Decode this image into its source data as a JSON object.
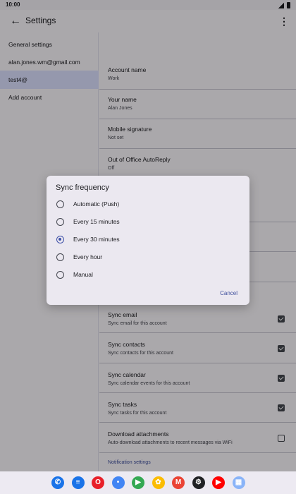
{
  "status": {
    "time": "10:00"
  },
  "appbar": {
    "title": "Settings",
    "back_icon": "arrow-back-icon",
    "more_icon": "more-vert-icon"
  },
  "accounts": [
    {
      "label": "General settings",
      "selected": false
    },
    {
      "label": "alan.jones.wm@gmail.com",
      "selected": false
    },
    {
      "label": "test4@",
      "selected": true
    },
    {
      "label": "Add account",
      "selected": false
    }
  ],
  "prefs": [
    {
      "title": "Account name",
      "subtitle": "Work"
    },
    {
      "title": "Your name",
      "subtitle": "Alan Jones"
    },
    {
      "title": "Mobile signature",
      "subtitle": "Not set"
    },
    {
      "title": "Out of Office AutoReply",
      "subtitle": "Off"
    }
  ],
  "sync_prefs": [
    {
      "title": "Sync email",
      "subtitle": "Sync email for this account",
      "checked": true
    },
    {
      "title": "Sync contacts",
      "subtitle": "Sync contacts for this account",
      "checked": true
    },
    {
      "title": "Sync calendar",
      "subtitle": "Sync calendar events for this account",
      "checked": true
    },
    {
      "title": "Sync tasks",
      "subtitle": "Sync tasks for this account",
      "checked": true
    },
    {
      "title": "Download attachments",
      "subtitle": "Auto-download attachments to recent messages via WiFi",
      "checked": false
    }
  ],
  "section_link": "Notification settings",
  "dialog": {
    "title": "Sync frequency",
    "options": [
      {
        "label": "Automatic (Push)",
        "selected": false
      },
      {
        "label": "Every 15 minutes",
        "selected": false
      },
      {
        "label": "Every 30 minutes",
        "selected": true
      },
      {
        "label": "Every hour",
        "selected": false
      },
      {
        "label": "Manual",
        "selected": false
      }
    ],
    "cancel": "Cancel"
  },
  "dock": [
    {
      "name": "phone-app-icon",
      "glyph": "✆",
      "color": "#1a73e8"
    },
    {
      "name": "messages-app-icon",
      "glyph": "≡",
      "color": "#1a73e8"
    },
    {
      "name": "opera-app-icon",
      "glyph": "O",
      "color": "#e8202a"
    },
    {
      "name": "assistant-app-icon",
      "glyph": "•",
      "color": "#4285f4"
    },
    {
      "name": "play-store-app-icon",
      "glyph": "▶",
      "color": "#34a853"
    },
    {
      "name": "photos-app-icon",
      "glyph": "✿",
      "color": "#fbbc04"
    },
    {
      "name": "gmail-app-icon",
      "glyph": "M",
      "color": "#ea4335"
    },
    {
      "name": "settings-app-icon",
      "glyph": "⚙",
      "color": "#202124"
    },
    {
      "name": "youtube-music-app-icon",
      "glyph": "▶",
      "color": "#ff0000"
    },
    {
      "name": "app-drawer-icon",
      "glyph": "▦",
      "color": "#8ab4f8"
    }
  ]
}
